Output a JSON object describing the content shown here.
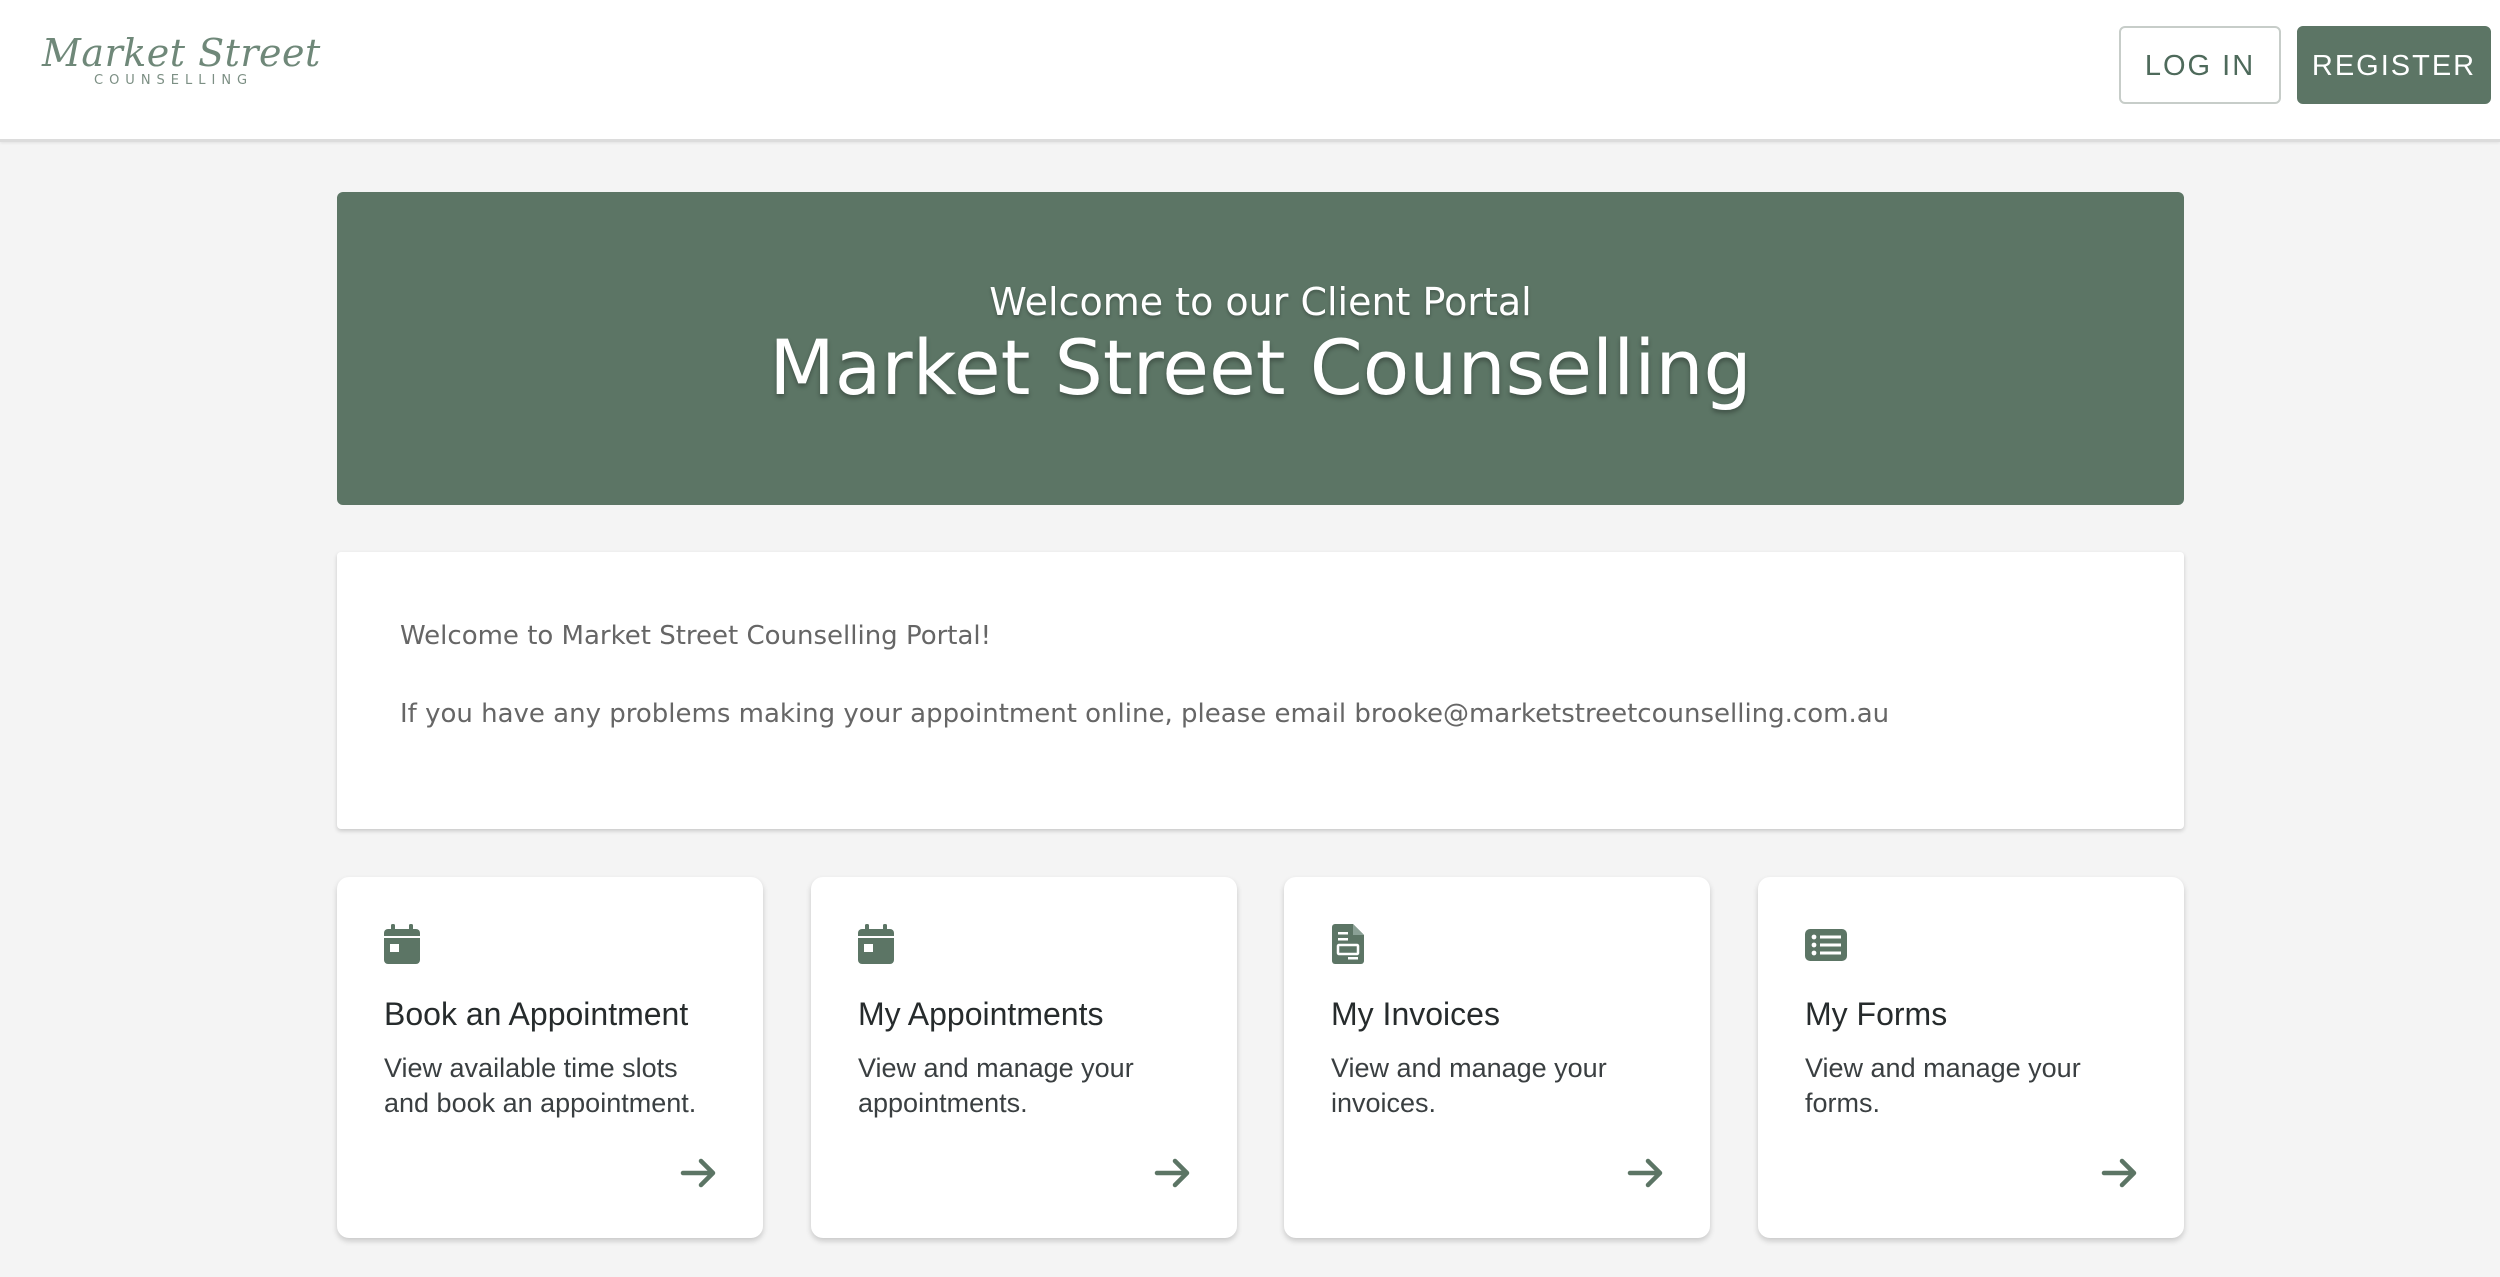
{
  "header": {
    "logo_script": "Market Street",
    "logo_sub": "COUNSELLING",
    "login_label": "LOG IN",
    "register_label": "REGISTER"
  },
  "hero": {
    "subtitle": "Welcome to our Client Portal",
    "title": "Market Street Counselling"
  },
  "welcome": {
    "line1": "Welcome to Market Street Counselling Portal!",
    "line2": "If you have any problems making your appointment online, please email brooke@marketstreetcounselling.com.au"
  },
  "cards": [
    {
      "icon": "calendar-icon",
      "title": "Book an Appointment",
      "desc": "View available time slots and book an appointment."
    },
    {
      "icon": "calendar-icon",
      "title": "My Appointments",
      "desc": "View and manage your appointments."
    },
    {
      "icon": "invoice-icon",
      "title": "My Invoices",
      "desc": "View and manage your invoices."
    },
    {
      "icon": "list-icon",
      "title": "My Forms",
      "desc": "View and manage your forms."
    }
  ],
  "colors": {
    "brand": "#5c7565",
    "background": "#f4f4f4",
    "card": "#ffffff"
  }
}
